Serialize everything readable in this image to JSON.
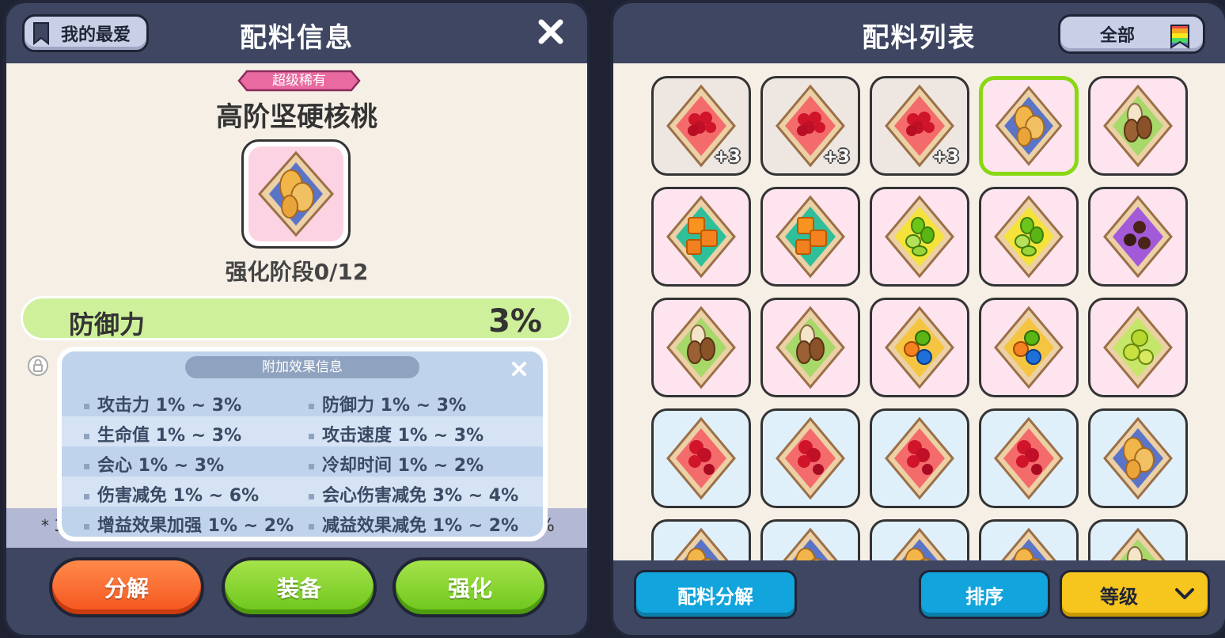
{
  "left_panel": {
    "favorite_label": "我的最爱",
    "title": "配料信息",
    "rarity": "超级稀有",
    "item_name": "高阶坚硬核桃",
    "enhance_stage": "强化阶段0/12",
    "main_stat": {
      "label": "防御力",
      "value": "3%"
    },
    "popup": {
      "title": "附加效果信息",
      "effects": [
        [
          "攻击力 1% ~ 3%",
          "防御力 1% ~ 3%"
        ],
        [
          "生命值 1% ~ 3%",
          "攻击速度 1% ~ 3%"
        ],
        [
          "会心 1% ~ 3%",
          "冷却时间 1% ~ 2%"
        ],
        [
          "伤害减免 1% ~ 6%",
          "会心伤害减免 3% ~ 4%"
        ],
        [
          "增益效果加强 1% ~ 2%",
          "减益效果减免 1% ~ 2%"
        ]
      ]
    },
    "strip_left": "* 3",
    "strip_right": "%",
    "buttons": {
      "decompose": "分解",
      "equip": "装备",
      "enhance": "强化"
    }
  },
  "right_panel": {
    "title": "配料列表",
    "filter_label": "全部",
    "grid": [
      {
        "item": "red-berry-topping",
        "bg": "beige",
        "level": "+3"
      },
      {
        "item": "red-berry-topping",
        "bg": "beige",
        "level": "+3"
      },
      {
        "item": "red-berry-topping",
        "bg": "beige",
        "level": "+3"
      },
      {
        "item": "walnut-topping",
        "bg": "pink",
        "selected": true
      },
      {
        "item": "almond-topping",
        "bg": "pink"
      },
      {
        "item": "caramel-topping",
        "bg": "pink"
      },
      {
        "item": "caramel-topping",
        "bg": "pink"
      },
      {
        "item": "green-jelly-topping",
        "bg": "pink"
      },
      {
        "item": "green-jelly-topping",
        "bg": "pink"
      },
      {
        "item": "chocolate-topping",
        "bg": "pink"
      },
      {
        "item": "almond-topping",
        "bg": "pink"
      },
      {
        "item": "almond-topping",
        "bg": "pink"
      },
      {
        "item": "candy-topping",
        "bg": "pink"
      },
      {
        "item": "candy-topping",
        "bg": "pink"
      },
      {
        "item": "kiwi-topping",
        "bg": "pink"
      },
      {
        "item": "raspberry-topping",
        "bg": "blue"
      },
      {
        "item": "raspberry-topping",
        "bg": "blue"
      },
      {
        "item": "raspberry-topping",
        "bg": "blue"
      },
      {
        "item": "raspberry-topping",
        "bg": "blue"
      },
      {
        "item": "walnut-topping",
        "bg": "blue"
      },
      {
        "item": "walnut-topping",
        "bg": "blue"
      },
      {
        "item": "walnut-topping",
        "bg": "blue"
      },
      {
        "item": "walnut-topping",
        "bg": "blue"
      },
      {
        "item": "walnut-topping",
        "bg": "blue"
      },
      {
        "item": "almond-topping",
        "bg": "blue"
      }
    ],
    "buttons": {
      "decompose_list": "配料分解",
      "sort": "排序",
      "level": "等级"
    }
  },
  "colors": {
    "panel": "#3e4662",
    "content_bg": "#f5efe6",
    "stat_bar": "#cff09b",
    "orange_button": "#f4541e",
    "green_button": "#6cc51b",
    "blue_button": "#12a4dc",
    "yellow_button": "#f6c51e",
    "selected_border": "#8ad813"
  }
}
